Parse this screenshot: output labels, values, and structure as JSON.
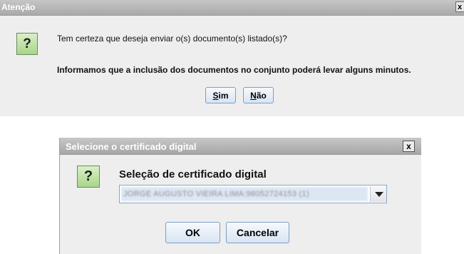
{
  "dialog1": {
    "title": "Atenção",
    "close": "x",
    "icon": "?",
    "message": "Tem certeza que deseja enviar o(s) documento(s) listado(s)?",
    "info": "Informamos que a inclusão dos documentos no conjunto poderá levar alguns minutos.",
    "yes_mnemonic": "S",
    "yes_rest": "im",
    "no_mnemonic": "N",
    "no_rest": "ão"
  },
  "dialog2": {
    "title": "Selecione o certificado digital",
    "close": "x",
    "icon": "?",
    "label": "Seleção de certificado digital",
    "selected_certificate": "JORGE AUGUSTO VIEIRA LIMA:98052724153 (1)",
    "ok": "OK",
    "cancel": "Cancelar"
  }
}
